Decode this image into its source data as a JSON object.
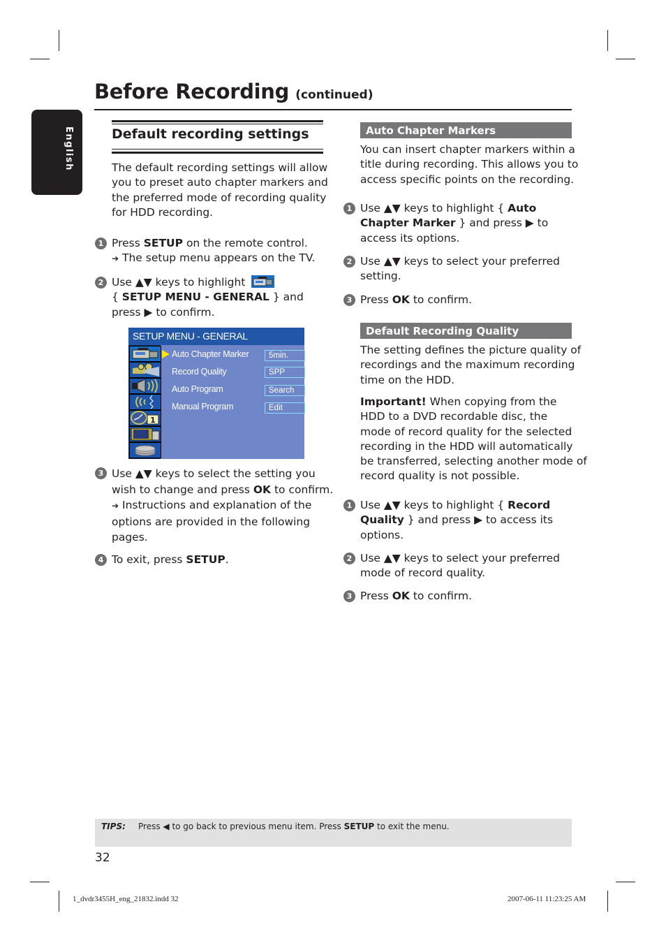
{
  "header": {
    "title": "Before Recording",
    "title_suffix": "(continued)"
  },
  "language_tab": "English",
  "left_column": {
    "section_title": "Default recording settings",
    "intro": [
      "The default recording settings will allow",
      "you to preset auto chapter markers and",
      "the preferred mode of recording quality",
      "for HDD recording."
    ],
    "steps": [
      {
        "num": "1",
        "pre": "Press ",
        "bold": "SETUP",
        "post": " on the remote control.",
        "result": "The setup menu appears on the TV."
      },
      {
        "num": "2",
        "pre": "Use ▲▼ keys to highlight",
        "bold": "SETUP MENU - GENERAL",
        "line2_pre": "{ ",
        "line2_post": " } and",
        "line3": "press ▶ to confirm."
      },
      {
        "num": "3",
        "line1": "Use ▲▼ keys to select the setting you",
        "line2_pre": "wish to change and press ",
        "bold": "OK",
        "line2_post": " to confirm.",
        "result_lines": [
          "Instructions and explanation of the",
          "options are provided in the following",
          "pages."
        ]
      },
      {
        "num": "4",
        "pre": "To exit, press ",
        "bold": "SETUP",
        "post": "."
      }
    ],
    "result_arrow": "➔"
  },
  "osd_menu": {
    "title": "SETUP MENU - GENERAL",
    "icons": [
      "camcorder-icon",
      "projector-icon",
      "speaker-icon",
      "signal-icon",
      "clock-icon",
      "tv-icon",
      "disc-stack-icon"
    ],
    "clock_badge": "1",
    "items": [
      {
        "label": "Auto Chapter Marker",
        "value": "5min.",
        "selected": true
      },
      {
        "label": "Record Quality",
        "value": "SPP"
      },
      {
        "label": "Auto Program",
        "value": "Search"
      },
      {
        "label": "Manual Program",
        "value": "Edit"
      }
    ]
  },
  "right_column": {
    "auto_chapter": {
      "heading": "Auto Chapter Markers",
      "body": [
        "You can insert chapter markers within a",
        "title during recording. This allows you to",
        "access specific points on the recording."
      ],
      "steps": [
        {
          "num": "1",
          "l1_pre": "Use ▲▼ keys to highlight { ",
          "l1_bold": "Auto",
          "l2_bold": "Chapter Marker",
          "l2_post": " } and press ▶ to",
          "l3": "access its options."
        },
        {
          "num": "2",
          "l1": "Use ▲▼ keys to select your preferred",
          "l2": "setting."
        },
        {
          "num": "3",
          "pre": "Press ",
          "bold": "OK",
          "post": " to confirm."
        }
      ]
    },
    "recording_quality": {
      "heading": "Default Recording Quality",
      "body": [
        "The setting defines the picture quality of",
        "recordings and the maximum recording",
        "time on the HDD."
      ],
      "important_label": "Important!",
      "important": [
        " When copying from the",
        "HDD to a DVD recordable disc, the",
        "mode of record quality for the selected",
        "recording in the HDD will automatically",
        "be transferred, selecting another mode of",
        "record quality is not possible."
      ],
      "steps": [
        {
          "num": "1",
          "l1_pre": "Use ▲▼ keys to highlight { ",
          "l1_bold": "Record",
          "l2_bold": "Quality",
          "l2_post": " } and press ▶ to access its",
          "l3": "options."
        },
        {
          "num": "2",
          "l1": "Use ▲▼ keys to select your preferred",
          "l2": "mode of record quality."
        },
        {
          "num": "3",
          "pre": "Press ",
          "bold": "OK",
          "post": " to confirm."
        }
      ]
    }
  },
  "tips": {
    "label": "TIPS:",
    "pre": "Press ◀ to go back to previous menu item. Press ",
    "bold": "SETUP",
    "post": " to exit the menu."
  },
  "page_number": "32",
  "slug": {
    "file": "1_dvdr3455H_eng_21832.indd   32",
    "timestamp": "2007-06-11   11:23:25 AM"
  }
}
